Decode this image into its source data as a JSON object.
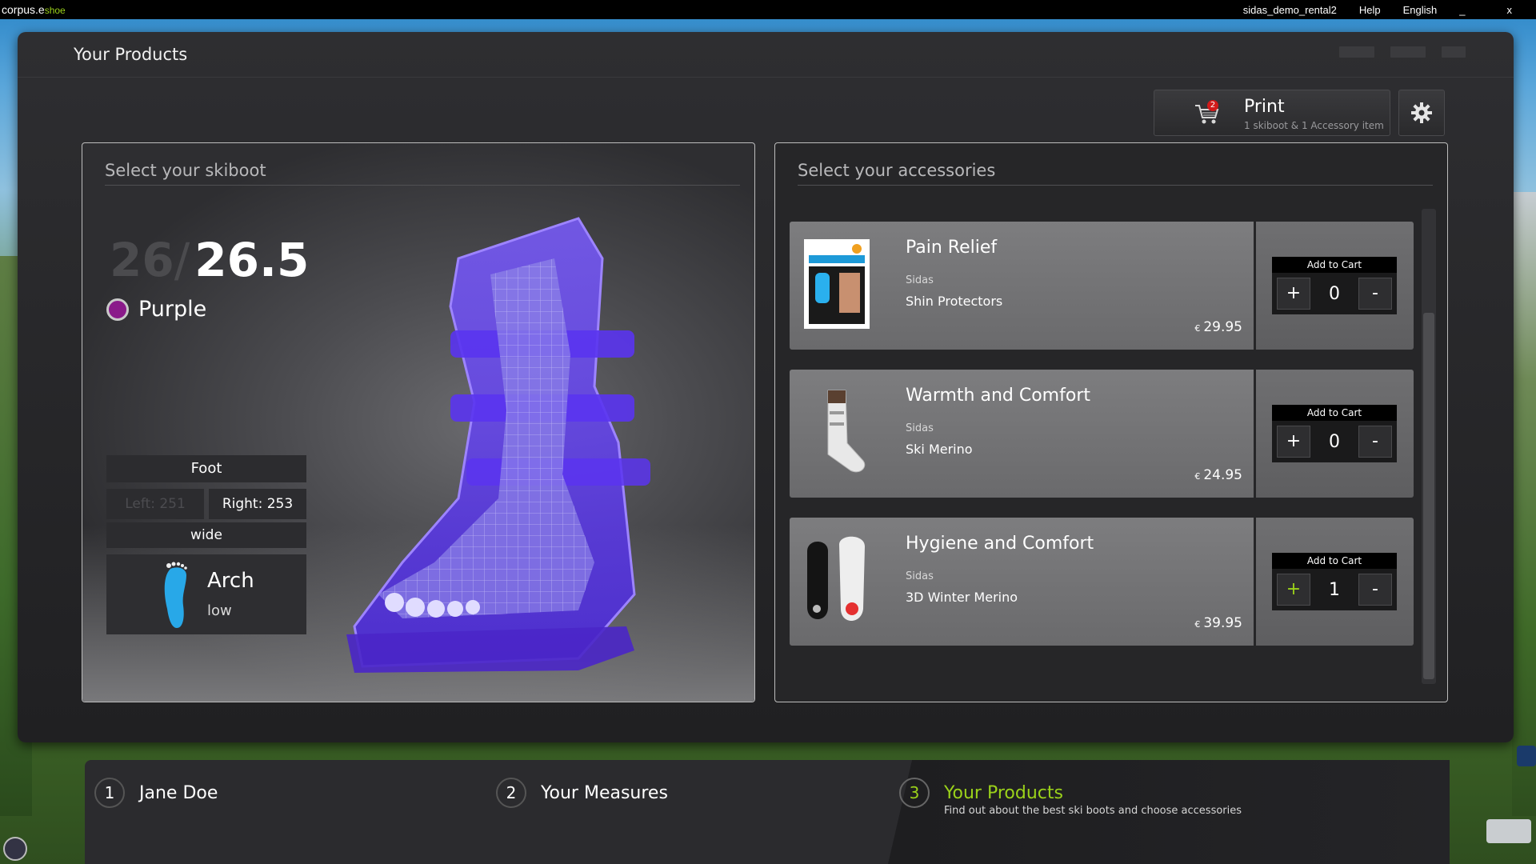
{
  "sysbar": {
    "brand": "corpus.e",
    "brand_suffix": "shoe",
    "user": "sidas_demo_rental2",
    "help": "Help",
    "language": "English",
    "minimize": "_",
    "close": "x"
  },
  "window": {
    "title": "Your Products"
  },
  "print": {
    "label": "Print",
    "subtitle": "1 skiboot & 1 Accessory item",
    "badge": "2"
  },
  "skiboot": {
    "heading": "Select your skiboot",
    "size_eu": "26",
    "size_slash": "/",
    "size_mondo": "26.5",
    "color_name": "Purple",
    "color_hex": "#8a1a8a",
    "foot_label": "Foot",
    "left": "Left: 251",
    "right": "Right: 253",
    "width": "wide",
    "arch_title": "Arch",
    "arch_value": "low"
  },
  "accessories": {
    "heading": "Select your accessories",
    "add_to_cart": "Add to Cart",
    "plus": "+",
    "minus": "-",
    "currency": "€",
    "items": [
      {
        "title": "Pain Relief",
        "brand": "Sidas",
        "product": "Shin Protectors",
        "price": "29.95",
        "qty": "0"
      },
      {
        "title": "Warmth and Comfort",
        "brand": "Sidas",
        "product": "Ski Merino",
        "price": "24.95",
        "qty": "0"
      },
      {
        "title": "Hygiene and Comfort",
        "brand": "Sidas",
        "product": "3D Winter Merino",
        "price": "39.95",
        "qty": "1"
      }
    ]
  },
  "steps": [
    {
      "num": "1",
      "label": "Jane Doe"
    },
    {
      "num": "2",
      "label": "Your Measures"
    },
    {
      "num": "3",
      "label": "Your Products",
      "sub": "Find out about the best ski boots and choose accessories"
    }
  ],
  "colors": {
    "accent": "#9bd21a",
    "boot": "#6a3cff"
  }
}
